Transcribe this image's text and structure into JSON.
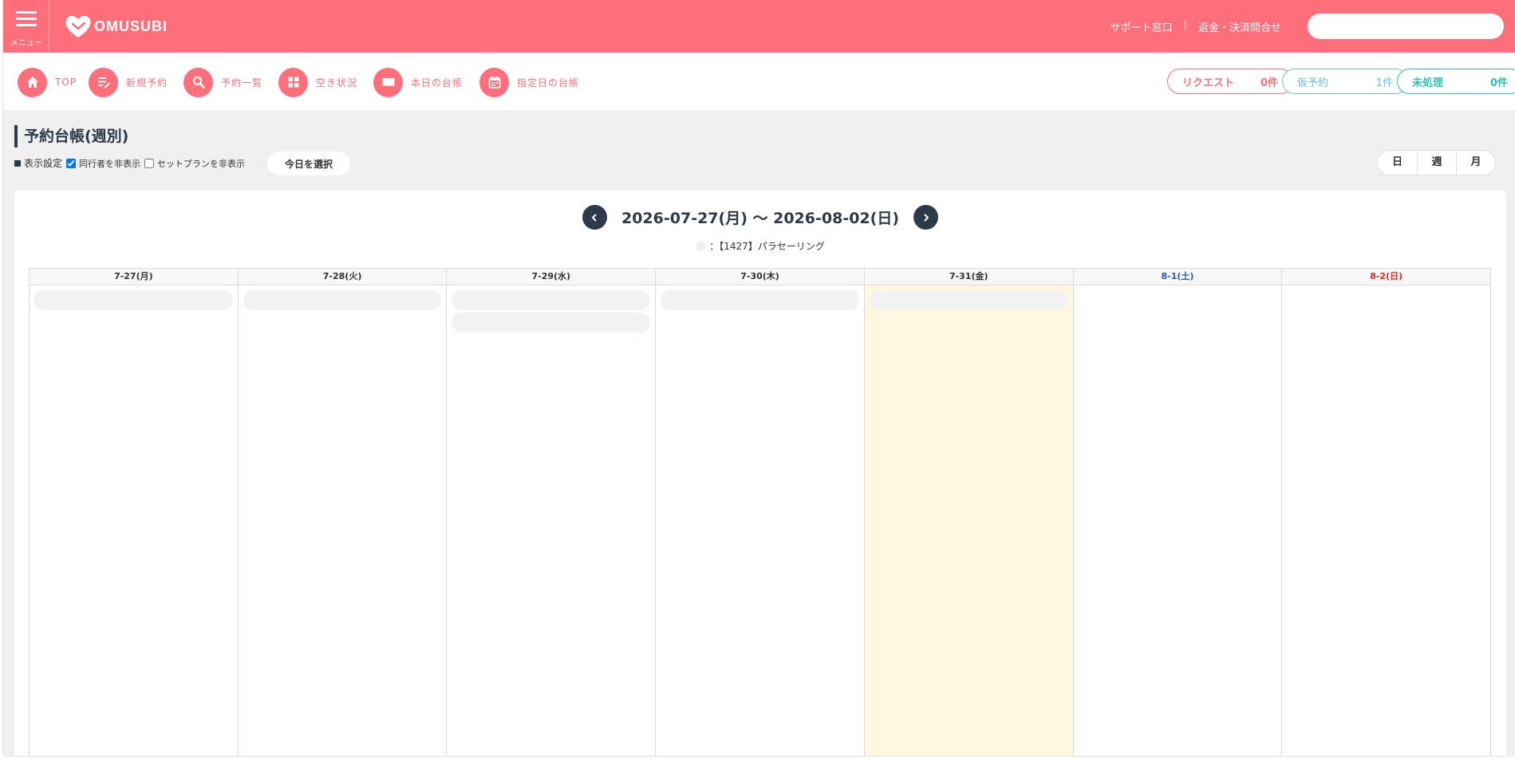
{
  "header": {
    "menu_label": "メニュー",
    "logo_text": "OMUSUBI",
    "links": [
      "サポート窓口",
      "返金・決済問合せ"
    ],
    "link_separator": "|",
    "search_value": ""
  },
  "nav": {
    "items": [
      {
        "label": "TOP",
        "icon": "home-icon"
      },
      {
        "label": "新規予約",
        "icon": "edit-list-icon"
      },
      {
        "label": "予約一覧",
        "icon": "search-icon"
      },
      {
        "label": "空き状況",
        "icon": "grid-icon"
      },
      {
        "label": "本日の台帳",
        "icon": "book-icon"
      },
      {
        "label": "指定日の台帳",
        "icon": "calendar-icon"
      }
    ],
    "counters": [
      {
        "label": "リクエスト",
        "count": "0件",
        "color": "#ff6f7b"
      },
      {
        "label": "仮予約",
        "count": "1件",
        "color": "#6cbfe8"
      },
      {
        "label": "未処理",
        "count": "0件",
        "color": "#2dc4ad"
      }
    ]
  },
  "page": {
    "title": "予約台帳(週別)",
    "settings_label": "表示設定",
    "options": [
      {
        "label": "同行者を非表示",
        "checked": true
      },
      {
        "label": "セットプランを非表示",
        "checked": false
      }
    ],
    "today_button": "今日を選択",
    "view_modes": [
      "日",
      "週",
      "月"
    ]
  },
  "calendar": {
    "range": "2026-07-27(月) ～ 2026-08-02(日)",
    "legend": "：【1427】パラセーリング",
    "days": [
      {
        "label": "7-27(月)",
        "type": "weekday",
        "today": false,
        "bookings": 1
      },
      {
        "label": "7-28(火)",
        "type": "weekday",
        "today": false,
        "bookings": 1
      },
      {
        "label": "7-29(水)",
        "type": "weekday",
        "today": false,
        "bookings": 2
      },
      {
        "label": "7-30(木)",
        "type": "weekday",
        "today": false,
        "bookings": 1
      },
      {
        "label": "7-31(金)",
        "type": "weekday",
        "today": true,
        "bookings": 1
      },
      {
        "label": "8-1(土)",
        "type": "saturday",
        "today": false,
        "bookings": 0
      },
      {
        "label": "8-2(日)",
        "type": "sunday",
        "today": false,
        "bookings": 0
      }
    ]
  },
  "colors": {
    "brand": "#ff6f7b",
    "navy": "#2d3a4a",
    "today_highlight": "#fff8df",
    "saturday": "#2b57c5",
    "sunday": "#e02525"
  }
}
